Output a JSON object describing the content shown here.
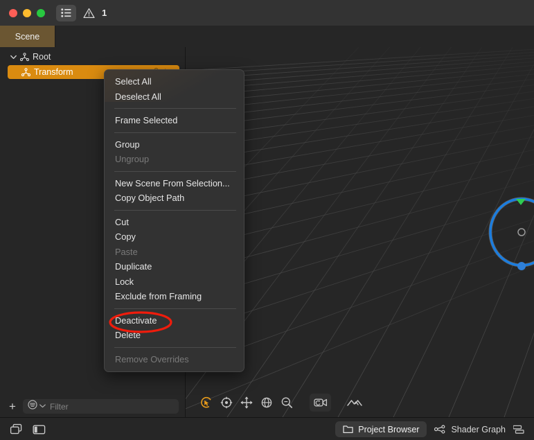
{
  "window": {
    "traffic_lights": [
      {
        "name": "close",
        "color": "#ff5f57"
      },
      {
        "name": "minimize",
        "color": "#febc2e"
      },
      {
        "name": "zoom",
        "color": "#28c840"
      }
    ],
    "toolbar": {
      "outline_toggle_label": "outline-list-icon",
      "warning_icon_label": "warning-triangle-icon",
      "warning_count": "1"
    }
  },
  "tabs": [
    {
      "label": "Scene",
      "active": true
    }
  ],
  "outliner": {
    "rows": [
      {
        "label": "Root",
        "level": 0,
        "expanded": true,
        "selected": false,
        "icon": "node-graph-icon"
      },
      {
        "label": "Transform",
        "level": 1,
        "expanded": false,
        "selected": true,
        "icon": "node-graph-icon",
        "badges": [
          "lock-icon",
          "visibility-icon"
        ]
      }
    ],
    "footer": {
      "add_label": "+",
      "filter_placeholder": "Filter",
      "filter_value": "",
      "filter_icon": "filter-icon",
      "chevron": "chevron-down-icon"
    }
  },
  "context_menu": {
    "groups": [
      {
        "items": [
          {
            "label": "Select All",
            "disabled": false
          },
          {
            "label": "Deselect All",
            "disabled": false
          }
        ]
      },
      {
        "items": [
          {
            "label": "Frame Selected",
            "disabled": false
          }
        ]
      },
      {
        "items": [
          {
            "label": "Group",
            "disabled": false
          },
          {
            "label": "Ungroup",
            "disabled": true
          }
        ]
      },
      {
        "items": [
          {
            "label": "New Scene From Selection...",
            "disabled": false
          },
          {
            "label": "Copy Object Path",
            "disabled": false
          }
        ]
      },
      {
        "items": [
          {
            "label": "Cut",
            "disabled": false
          },
          {
            "label": "Copy",
            "disabled": false
          },
          {
            "label": "Paste",
            "disabled": true
          },
          {
            "label": "Duplicate",
            "disabled": false
          },
          {
            "label": "Lock",
            "disabled": false
          },
          {
            "label": "Exclude from Framing",
            "disabled": false
          }
        ]
      },
      {
        "items": [
          {
            "label": "Deactivate",
            "disabled": false,
            "highlighted": true
          },
          {
            "label": "Delete",
            "disabled": false
          }
        ]
      },
      {
        "items": [
          {
            "label": "Remove Overrides",
            "disabled": true
          }
        ]
      }
    ],
    "annotation_color": "#f01c0c"
  },
  "viewport": {
    "toolbar": [
      {
        "name": "orbit-tool",
        "selected": true
      },
      {
        "name": "target-tool",
        "selected": false
      },
      {
        "name": "move-tool",
        "selected": false
      },
      {
        "name": "pan-globe-tool",
        "selected": false
      },
      {
        "name": "zoom-tool",
        "selected": false
      },
      {
        "name": "camera-reset-tool",
        "selected": false,
        "boxed": true
      },
      {
        "name": "terrain-tool",
        "selected": false
      }
    ],
    "gizmo": {
      "ring_color": "#1a7de0",
      "handle_color_top": "#2ecc52",
      "handle_color_bottom": "#2f80d8"
    },
    "grid_color": "#3a3a3a",
    "background": "#262626"
  },
  "statusbar": {
    "left_icons": [
      {
        "name": "layers-panel-icon"
      },
      {
        "name": "side-panel-icon"
      }
    ],
    "right_items": [
      {
        "label": "Project Browser",
        "icon": "folder-icon",
        "active": true
      },
      {
        "label": "Shader Graph",
        "icon": "shader-nodes-icon",
        "active": false
      },
      {
        "label": "",
        "icon": "timeline-tracks-icon",
        "active": false
      }
    ]
  }
}
